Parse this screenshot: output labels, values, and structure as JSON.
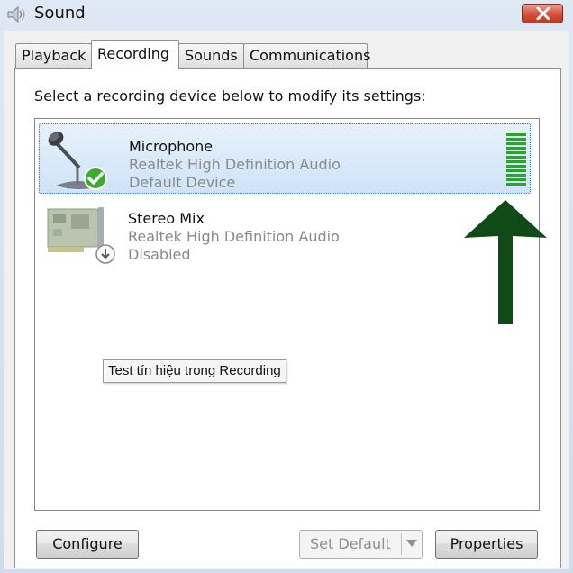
{
  "window": {
    "title": "Sound",
    "close_glyph": "✕"
  },
  "tabs": [
    {
      "label": "Playback",
      "active": false
    },
    {
      "label": "Recording",
      "active": true
    },
    {
      "label": "Sounds",
      "active": false
    },
    {
      "label": "Communications",
      "active": false
    }
  ],
  "instructions": "Select a recording device below to modify its settings:",
  "devices": [
    {
      "name": "Microphone",
      "driver": "Realtek High Definition Audio",
      "status": "Default Device",
      "icon": "microphone-icon",
      "badge": "checkmark-icon",
      "selected": true,
      "level_segments": 12
    },
    {
      "name": "Stereo Mix",
      "driver": "Realtek High Definition Audio",
      "status": "Disabled",
      "icon": "sound-card-icon",
      "badge": "disabled-down-arrow-icon",
      "selected": false
    }
  ],
  "tooltip": "Test tín hiệu trong Recording",
  "buttons": {
    "configure": {
      "mnemonic": "C",
      "rest": "onfigure"
    },
    "set_default": {
      "mnemonic": "S",
      "rest": "et Default",
      "disabled": true
    },
    "properties": {
      "mnemonic": "P",
      "rest": "roperties"
    }
  },
  "colors": {
    "level_meter": "#28a62a",
    "arrow": "#0f4a17",
    "selection": "#cfe3f8"
  }
}
